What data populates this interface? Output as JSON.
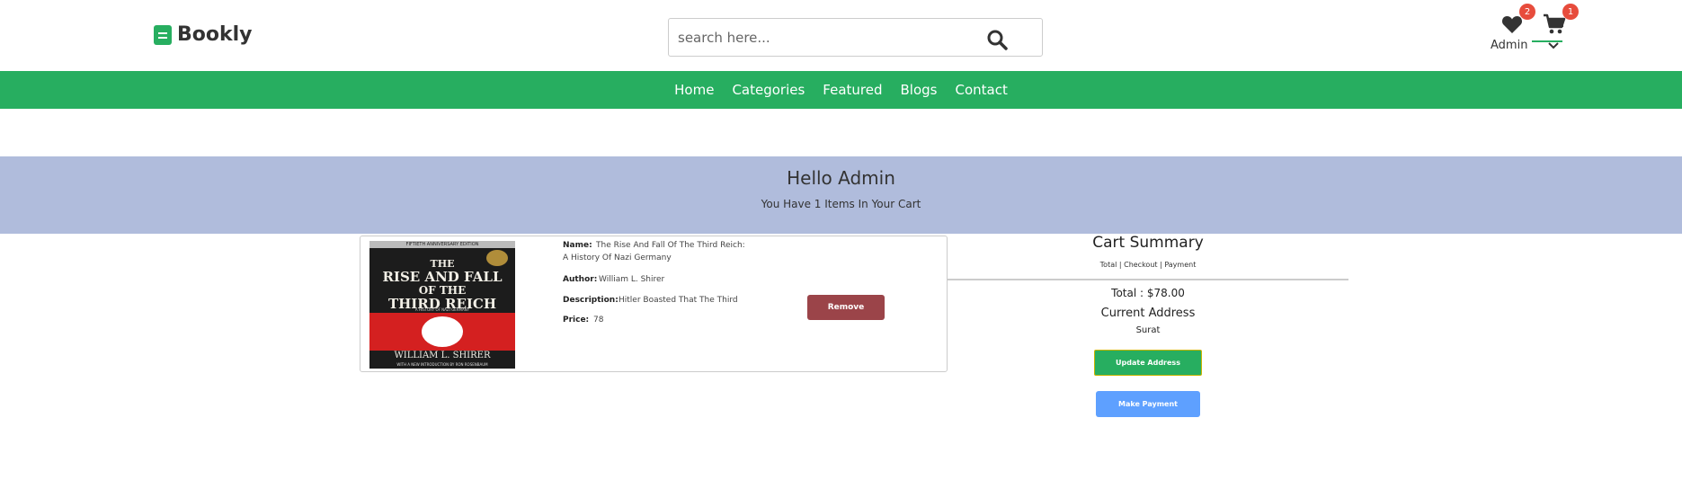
{
  "brand": {
    "name": "Bookly"
  },
  "search": {
    "placeholder": "search here..."
  },
  "header": {
    "wishlist_count": "2",
    "cart_count": "1",
    "user_label": "Admin"
  },
  "nav": {
    "items": [
      {
        "label": "Home"
      },
      {
        "label": "Categories"
      },
      {
        "label": "Featured"
      },
      {
        "label": "Blogs"
      },
      {
        "label": "Contact"
      }
    ]
  },
  "greeting": {
    "title": "Hello Admin",
    "subtitle": "You Have 1 Items In Your Cart"
  },
  "cart_item": {
    "cover": {
      "top_text": "FIFTIETH ANNIVERSARY EDITION",
      "title_lines": [
        "THE",
        "RISE AND FALL",
        "OF THE",
        "THIRD REICH"
      ],
      "subtitle": "A HISTORY OF NAZI GERMANY",
      "author": "WILLIAM L. SHIRER",
      "footer": "WITH A NEW INTRODUCTION BY RON ROSENBAUM"
    },
    "name_label": "Name:",
    "name_line1": "The Rise And Fall Of The Third Reich:",
    "name_line2": "A History Of Nazi Germany",
    "author_label": "Author:",
    "author_value": "William L. Shirer",
    "description_label": "Description:",
    "description_value": "Hitler Boasted That The Third",
    "price_label": "Price:",
    "price_value": "78",
    "remove_label": "Remove"
  },
  "summary": {
    "title": "Cart Summary",
    "subtitle": "Total | Checkout | Payment",
    "total": "Total : $78.00",
    "address_heading": "Current Address",
    "address": "Surat",
    "update_label": "Update Address",
    "payment_label": "Make Payment"
  },
  "colors": {
    "brand_green": "#27ae60",
    "band_blue": "#b0bcdc",
    "remove_red": "#9b4449",
    "payment_blue": "#5ea0ff",
    "badge_red": "#e74c3c"
  },
  "icons": [
    "book-icon",
    "search-icon",
    "heart-icon",
    "cart-icon",
    "chevron-down-icon"
  ]
}
